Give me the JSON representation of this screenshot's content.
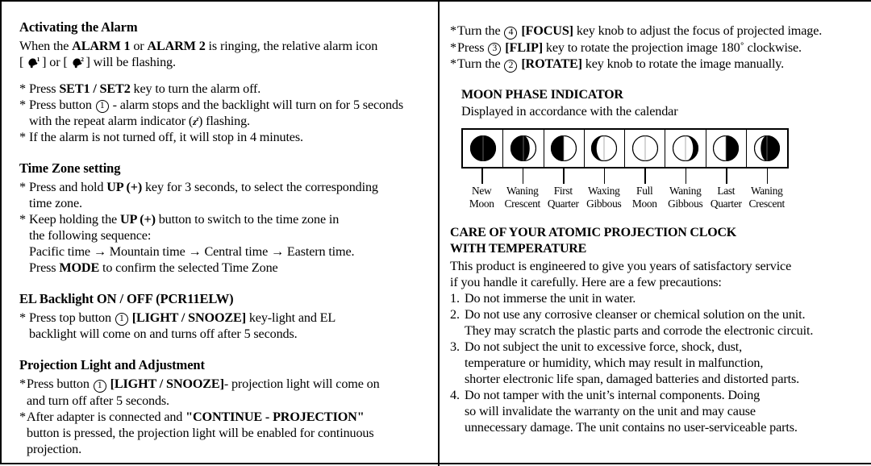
{
  "document": {
    "title": "Atomic Projection Clock Instruction Manual Page",
    "columns": 2
  },
  "left_column": {
    "sections": [
      {
        "id": "activating-the-alarm",
        "heading": "Activating the Alarm",
        "intro_line_1_before": "When the ",
        "intro_bold_1": "ALARM 1",
        "intro_mid": " or ",
        "intro_bold_2": "ALARM 2",
        "intro_line_1_after": " is ringing, the relative alarm icon",
        "intro_line_2_a": "[",
        "intro_line_2_b": "] or [",
        "intro_line_2_c": "] will be flashing.",
        "bullets": [
          {
            "marker": "*",
            "pre": "Press ",
            "bold": "SET1 / SET2",
            "post": " key to turn the alarm off."
          },
          {
            "marker": "*",
            "pre": "Press button ",
            "circled": "1",
            "post": " - alarm stops and the backlight will turn on for 5 seconds",
            "cont": "with the repeat alarm indicator (z²) flashing."
          },
          {
            "marker": "*",
            "pre": "If the alarm is not turned off, it will stop in 4 minutes.",
            "post": ""
          }
        ]
      },
      {
        "id": "time-zone-setting",
        "heading": "Time Zone setting",
        "bullets": [
          {
            "marker": "*",
            "pre": "Press and hold ",
            "bold": "UP (+)",
            "post": " key for 3 seconds, to select the corresponding",
            "cont": "time zone."
          },
          {
            "marker": "*",
            "pre": "Keep holding the ",
            "bold": "UP (+)",
            "post": " button to switch to the time zone in",
            "cont": "the following sequence:",
            "cont2": "Pacific time → Mountain time → Central time → Eastern time.",
            "cont3_pre": "Press ",
            "cont3_bold": "MODE",
            "cont3_post": " to confirm the selected Time Zone"
          }
        ]
      },
      {
        "id": "el-backlight",
        "heading": "EL Backlight ON / OFF (PCR11ELW)",
        "bullets": [
          {
            "marker": "*",
            "pre": "Press top button ",
            "circled": "1",
            "bold": " [LIGHT / SNOOZE]",
            "post": " key-light and EL",
            "cont": "backlight will come on and turns off after 5 seconds."
          }
        ]
      },
      {
        "id": "projection-light",
        "heading": "Projection Light and Adjustment",
        "bullets": [
          {
            "marker": "*",
            "pre": "Press button ",
            "circled": "1",
            "bold": " [LIGHT / SNOOZE]",
            "post": "- projection light will come on",
            "cont": "and turn off after 5 seconds."
          },
          {
            "marker": "*",
            "pre": "After adapter is connected and ",
            "bold": "\"CONTINUE - PROJECTION\"",
            "post": "",
            "cont": "button is pressed, the projection light will be enabled for continuous",
            "cont2": "projection."
          }
        ]
      }
    ]
  },
  "right_column": {
    "projection_controls": [
      {
        "marker": "*",
        "pre": "Turn the ",
        "circled": "4",
        "bold": " [FOCUS]",
        "post": " key knob to adjust the focus of projected image."
      },
      {
        "marker": "*",
        "pre": " Press ",
        "circled": "3",
        "bold": " [FLIP]",
        "post": " key to rotate the projection image 180˚ clockwise."
      },
      {
        "marker": "*",
        "pre": "Turn the ",
        "circled": "2",
        "bold": " [ROTATE]",
        "post": " key knob to rotate the image manually."
      }
    ],
    "moon_section": {
      "heading": "MOON PHASE INDICATOR",
      "subtitle": "Displayed in accordance with the calendar",
      "phases": [
        {
          "label_line1": "New",
          "label_line2": "Moon",
          "icon": "moon-new-dark",
          "lit": 0.0,
          "side": "none"
        },
        {
          "label_line1": "Waning",
          "label_line2": "Crescent",
          "icon": "moon-waning-crescent",
          "lit": 0.25,
          "side": "right"
        },
        {
          "label_line1": "First",
          "label_line2": "Quarter",
          "icon": "moon-first-quarter",
          "lit": 0.5,
          "side": "right"
        },
        {
          "label_line1": "Waxing",
          "label_line2": "Gibbous",
          "icon": "moon-waxing-gibbous",
          "lit": 0.8,
          "side": "right"
        },
        {
          "label_line1": "Full",
          "label_line2": "Moon",
          "icon": "moon-full",
          "lit": 1.0,
          "side": "none"
        },
        {
          "label_line1": "Waning",
          "label_line2": "Gibbous",
          "icon": "moon-waning-gibbous",
          "lit": 0.8,
          "side": "left"
        },
        {
          "label_line1": "Last",
          "label_line2": "Quarter",
          "icon": "moon-last-quarter",
          "lit": 0.5,
          "side": "left"
        },
        {
          "label_line1": "Waning",
          "label_line2": "Crescent",
          "icon": "moon-waning-crescent2",
          "lit": 0.25,
          "side": "left"
        }
      ]
    },
    "care_section": {
      "heading_line1": "CARE OF YOUR ATOMIC PROJECTION CLOCK",
      "heading_line2": "WITH TEMPERATURE",
      "intro_line1": "This product is engineered to give you years of satisfactory service",
      "intro_line2": "if you handle it carefully. Here are a few precautions:",
      "items": [
        {
          "num": "1.",
          "line1": "Do not immerse the unit in water."
        },
        {
          "num": "2.",
          "line1": "Do not use any corrosive cleanser or chemical solution on the unit.",
          "line2": "They may scratch the plastic parts and corrode the electronic circuit."
        },
        {
          "num": "3.",
          "line1": "Do not subject the unit to excessive force, shock, dust,",
          "line2": "temperature or humidity, which may result in malfunction,",
          "line3": "shorter electronic life span, damaged batteries and distorted parts."
        },
        {
          "num": "4.",
          "line1": "Do not tamper with the unit’s internal components. Doing",
          "line2": "so will invalidate the warranty on the unit and may cause",
          "line3": "unnecessary damage. The unit contains no user-serviceable parts."
        }
      ]
    }
  },
  "colors": {
    "ink": "#000000",
    "paper": "#ffffff"
  }
}
